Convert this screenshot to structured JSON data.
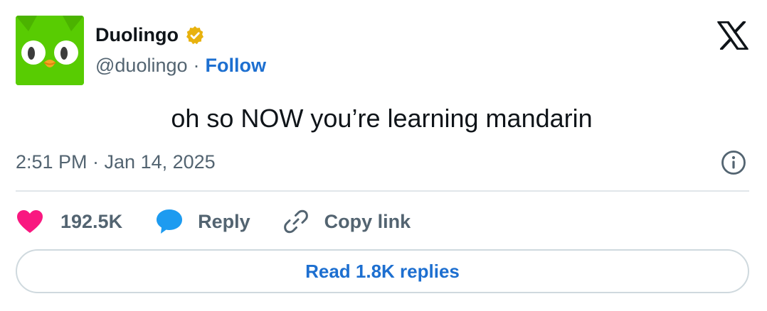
{
  "author": {
    "display_name": "Duolingo",
    "handle": "@duolingo",
    "separator": "·",
    "follow_label": "Follow",
    "verified_color": "#e8b20e",
    "avatar_color": "#58cc02"
  },
  "tweet": {
    "text": "oh so NOW you’re learning mandarin",
    "timestamp": "2:51 PM · Jan 14, 2025"
  },
  "actions": {
    "like_count": "192.5K",
    "reply_label": "Reply",
    "copy_link_label": "Copy link",
    "like_color": "#f91880",
    "reply_color": "#1d9bf0"
  },
  "footer": {
    "read_replies_label": "Read 1.8K replies"
  },
  "icons": [
    "avatar-owl-icon",
    "verified-badge-icon",
    "x-logo-icon",
    "info-icon",
    "heart-icon",
    "reply-bubble-icon",
    "link-icon"
  ]
}
